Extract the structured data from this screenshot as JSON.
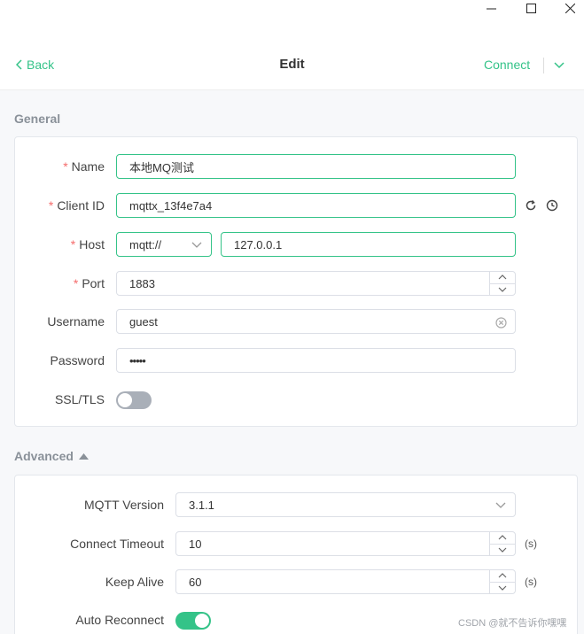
{
  "window": {
    "minimize_icon": "minimize-icon",
    "maximize_icon": "maximize-icon",
    "close_icon": "close-icon"
  },
  "header": {
    "back_label": "Back",
    "title": "Edit",
    "connect_label": "Connect"
  },
  "general": {
    "section_title": "General",
    "name": {
      "label": "Name",
      "value": "本地MQ测试",
      "required": true
    },
    "client_id": {
      "label": "Client ID",
      "value": "mqttx_13f4e7a4",
      "required": true
    },
    "host": {
      "label": "Host",
      "protocol": "mqtt://",
      "value": "127.0.0.1",
      "required": true
    },
    "port": {
      "label": "Port",
      "value": "1883",
      "required": true
    },
    "username": {
      "label": "Username",
      "value": "guest"
    },
    "password": {
      "label": "Password",
      "value": "•••••"
    },
    "ssl": {
      "label": "SSL/TLS",
      "enabled": false
    }
  },
  "advanced": {
    "section_title": "Advanced",
    "mqtt_version": {
      "label": "MQTT Version",
      "value": "3.1.1"
    },
    "connect_timeout": {
      "label": "Connect Timeout",
      "value": "10",
      "unit": "(s)"
    },
    "keep_alive": {
      "label": "Keep Alive",
      "value": "60",
      "unit": "(s)"
    },
    "auto_reconnect": {
      "label": "Auto Reconnect",
      "enabled": true
    }
  },
  "watermark": "CSDN @就不告诉你嘿嘿",
  "colors": {
    "accent": "#34c388",
    "required": "#f56c6c",
    "toggle_off": "#a9afb8"
  }
}
